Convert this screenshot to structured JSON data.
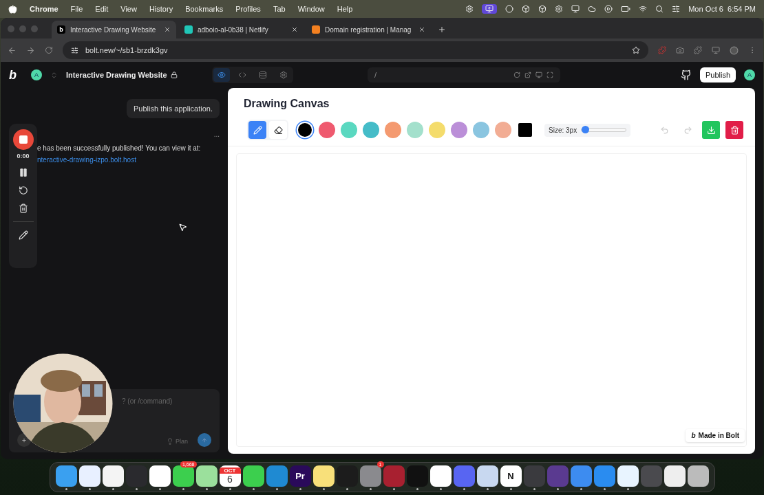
{
  "menu_bar": {
    "app": "Chrome",
    "menus": [
      "File",
      "Edit",
      "View",
      "History",
      "Bookmarks",
      "Profiles",
      "Tab",
      "Window",
      "Help"
    ],
    "clock": "Mon Oct 6  6:54 PM"
  },
  "browser": {
    "tabs": [
      {
        "title": "Interactive Drawing Website",
        "kind": "bolt",
        "selected": true,
        "icon": "b"
      },
      {
        "title": "adboio-al-0b38 | Netlify",
        "kind": "netlify",
        "selected": false
      },
      {
        "title": "Domain registration | Manag",
        "kind": "cloud",
        "selected": false
      }
    ],
    "url": "bolt.new/~/sb1-brzdk3gv"
  },
  "app_header": {
    "logo": "b",
    "avatar": "A",
    "project": "Interactive Drawing Website",
    "views": [
      {
        "kind": "preview",
        "selected": true
      },
      {
        "kind": "code",
        "selected": false
      },
      {
        "kind": "database",
        "selected": false
      },
      {
        "kind": "settings",
        "selected": false
      }
    ],
    "path": "/",
    "publish": "Publish",
    "user": "A"
  },
  "chat": {
    "user_message": "Publish this application.",
    "more": "...",
    "reply": "e has been successfully published! You can view it at:",
    "link": "nteractive-drawing-izpo.bolt.host",
    "recorder_time": "0:00",
    "input_placeholder": "? (or /command)",
    "plan": "Plan"
  },
  "canvas": {
    "title": "Drawing Canvas",
    "tools": [
      {
        "kind": "pencil",
        "selected": true
      },
      {
        "kind": "eraser",
        "selected": false
      }
    ],
    "colors": [
      {
        "color": "#000000",
        "kind": "swatch",
        "selected": true
      },
      {
        "color": "#ef5a6f",
        "kind": "swatch",
        "selected": false
      },
      {
        "color": "#5ad8c0",
        "kind": "swatch",
        "selected": false
      },
      {
        "color": "#45bcc8",
        "kind": "swatch",
        "selected": false
      },
      {
        "color": "#f49a70",
        "kind": "swatch",
        "selected": false
      },
      {
        "color": "#a3e0cc",
        "kind": "swatch",
        "selected": false
      },
      {
        "color": "#f4dc6c",
        "kind": "swatch",
        "selected": false
      },
      {
        "color": "#bb8fd8",
        "kind": "swatch",
        "selected": false
      },
      {
        "color": "#8ac5e0",
        "kind": "swatch",
        "selected": false
      },
      {
        "color": "#f2ad94",
        "kind": "swatch",
        "selected": false
      },
      {
        "color": "#000000",
        "kind": "picker",
        "selected": false
      }
    ],
    "size_label": "Size: 3px",
    "size": {
      "level": 0.0
    },
    "undo": {
      "disabled": true
    },
    "redo": {
      "disabled": true
    },
    "badge": "Made in Bolt",
    "badge_logo": "b"
  },
  "dock": [
    {
      "kind": "finder",
      "running": true
    },
    {
      "kind": "safari",
      "running": true
    },
    {
      "kind": "chrome",
      "running": true
    },
    {
      "kind": "layers",
      "running": true
    },
    {
      "kind": "slack",
      "running": true
    },
    {
      "kind": "messages",
      "running": true,
      "badge": "1,668"
    },
    {
      "kind": "maps",
      "running": true
    },
    {
      "kind": "calendar",
      "running": true,
      "label": "6",
      "top": "OCT"
    },
    {
      "kind": "facetime",
      "running": true
    },
    {
      "kind": "vscode",
      "running": true
    },
    {
      "kind": "premiere",
      "running": true,
      "label": "Pr"
    },
    {
      "kind": "notes",
      "running": true
    },
    {
      "kind": "terminal",
      "running": true
    },
    {
      "kind": "settings",
      "running": true,
      "badge": "1"
    },
    {
      "kind": "database",
      "running": true
    },
    {
      "kind": "spotify",
      "running": true
    },
    {
      "kind": "openai",
      "running": true
    },
    {
      "kind": "discord",
      "running": true
    },
    {
      "kind": "preview",
      "running": true
    },
    {
      "kind": "notion",
      "running": true,
      "label": "N"
    },
    {
      "kind": "cube",
      "running": true
    },
    {
      "kind": "orb",
      "running": true
    },
    {
      "kind": "xcode",
      "running": true
    },
    {
      "kind": "appstore",
      "running": true
    },
    {
      "kind": "keys",
      "running": true
    },
    {
      "kind": "window",
      "running": false
    },
    {
      "kind": "document",
      "running": false
    },
    {
      "kind": "trash",
      "running": false
    }
  ]
}
